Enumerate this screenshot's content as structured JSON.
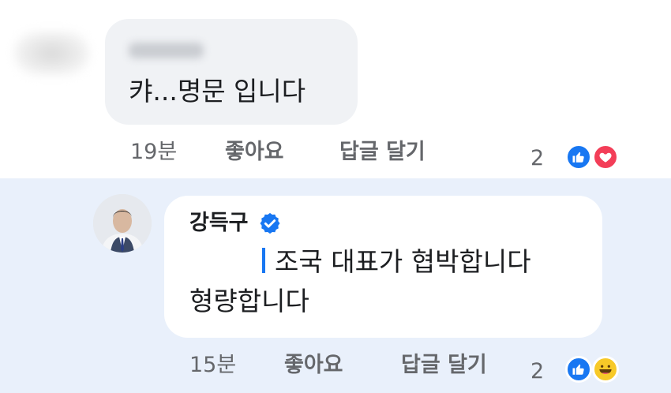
{
  "comment_1": {
    "text": "캬...명문 입니다",
    "time": "19분",
    "like_label": "좋아요",
    "reply_label": "답글 달기",
    "reaction_count": "2",
    "reactions": [
      "like-icon",
      "love-icon"
    ]
  },
  "comment_2": {
    "author": "강득구",
    "text_line1": "조국 대표가 협박합니다",
    "text_line2": "형량합니다",
    "time": "15분",
    "like_label": "좋아요",
    "reply_label": "답글 달기",
    "reaction_count": "2",
    "reactions": [
      "like-icon",
      "haha-icon"
    ]
  },
  "colors": {
    "like_blue": "#1877f2",
    "love_red": "#f33e58",
    "haha_yellow": "#f7c928",
    "highlight_bg": "#e9f0fb",
    "bubble_bg": "#f0f2f5",
    "muted_text": "#65676b"
  }
}
